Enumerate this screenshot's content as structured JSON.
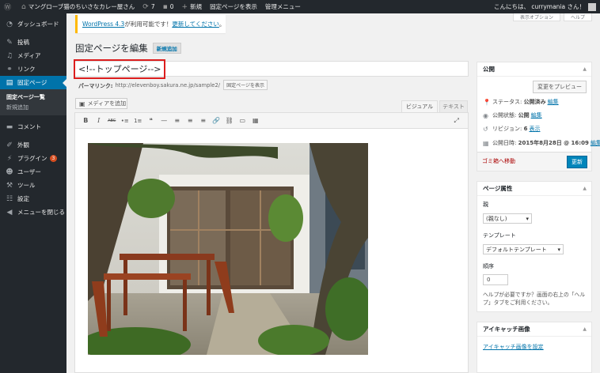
{
  "adminbar": {
    "site_name": "マングローブ猫のちいさなカレー屋さん",
    "updates": "7",
    "comments": "0",
    "new": "新規",
    "view_page": "固定ページを表示",
    "admin_menu": "管理メニュー",
    "greeting": "こんにちは、 currymania さん！"
  },
  "sidebar": {
    "items": [
      {
        "label": "ダッシュボード",
        "icon": "dashboard-icon"
      },
      {
        "label": "投稿",
        "icon": "pin-icon"
      },
      {
        "label": "メディア",
        "icon": "media-icon"
      },
      {
        "label": "リンク",
        "icon": "link-icon"
      },
      {
        "label": "固定ページ",
        "icon": "pages-icon"
      },
      {
        "label": "コメント",
        "icon": "comment-icon"
      },
      {
        "label": "外観",
        "icon": "brush-icon"
      },
      {
        "label": "プラグイン",
        "icon": "plugin-icon",
        "badge": "3"
      },
      {
        "label": "ユーザー",
        "icon": "user-icon"
      },
      {
        "label": "ツール",
        "icon": "wrench-icon"
      },
      {
        "label": "設定",
        "icon": "settings-icon"
      },
      {
        "label": "メニューを閉じる",
        "icon": "collapse-icon"
      }
    ],
    "sub": [
      "固定ページ一覧",
      "新規追加"
    ]
  },
  "notice": {
    "version_link": "WordPress 4.3",
    "middle": " が利用可能です！",
    "update_link": "更新してください",
    "end": "。"
  },
  "screen_tabs": [
    "表示オプション",
    "ヘルプ"
  ],
  "page": {
    "title": "固定ページを編集",
    "add_new": "新規追加"
  },
  "editor": {
    "post_title": "<!--トップページ-->",
    "permalink_label": "パーマリンク:",
    "permalink_url": "http://elevenboy.sakura.ne.jp/sample2/",
    "view_page_button": "固定ページを表示",
    "add_media": "メディアを追加",
    "tab_visual": "ビジュアル",
    "tab_text": "テキスト",
    "toolbar": [
      "B",
      "I",
      "ABC",
      "•≡",
      "1≡",
      "❝",
      "—",
      "≡",
      "≡",
      "≡",
      "🔗",
      "⛓",
      "▭",
      "▦"
    ],
    "expand_icon": "⤢",
    "image_alt": "cafe-terrace-photo"
  },
  "publish": {
    "title": "公開",
    "preview_button": "変更をプレビュー",
    "status_label": "ステータス:",
    "status_value": "公開済み",
    "visibility_label": "公開状態:",
    "visibility_value": "公開",
    "revision_label": "リビジョン:",
    "revision_value": "6",
    "revision_link": "表示",
    "date_label": "公開日時:",
    "date_value": "2015年8月28日 @ 16:09",
    "edit": "編集",
    "trash": "ゴミ箱へ移動",
    "update": "更新"
  },
  "attributes": {
    "title": "ページ属性",
    "parent_label": "親",
    "parent_value": "(親なし)",
    "template_label": "テンプレート",
    "template_value": "デフォルトテンプレート",
    "order_label": "順序",
    "order_value": "0",
    "help": "ヘルプが必要ですか？画面の右上の「ヘルプ」タブをご利用ください。"
  },
  "thumbnail": {
    "title": "アイキャッチ画像",
    "set_link": "アイキャッチ画像を設定"
  },
  "colors": {
    "admin_dark": "#23282d",
    "accent": "#0073aa",
    "highlight": "#dc1e1e",
    "primary_button": "#0085ba"
  }
}
